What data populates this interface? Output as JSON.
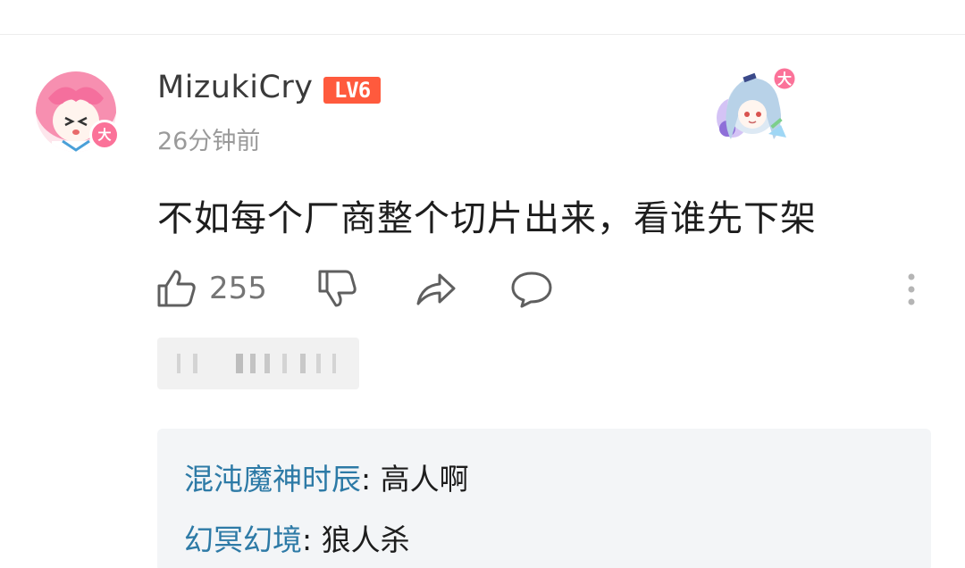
{
  "comment": {
    "author": {
      "name": "MizukiCry",
      "level": "LV6",
      "vip_badge": "大",
      "avatar_icon": "anime-pink-hair-avatar-icon"
    },
    "timestamp": "26分钟前",
    "garb_icon": "white-hair-anime-girl-decoration-icon",
    "garb_badge": "大",
    "text": "不如每个厂商整个切片出来，看谁先下架",
    "actions": {
      "like_count": "255",
      "like_icon": "thumb-up-icon",
      "dislike_icon": "thumb-down-icon",
      "share_icon": "share-icon",
      "reply_icon": "comment-icon",
      "more_icon": "more-vertical-icon"
    }
  },
  "replies": [
    {
      "author": "混沌魔神时辰",
      "separator": ": ",
      "text": "高人啊"
    },
    {
      "author": "幻冥幻境",
      "separator": ": ",
      "text": "狼人杀"
    }
  ],
  "colors": {
    "level_badge": "#ff5a3d",
    "vip_pink": "#fb7299",
    "reply_author": "#2d7aa6",
    "reply_panel_bg": "#f3f5f7"
  }
}
